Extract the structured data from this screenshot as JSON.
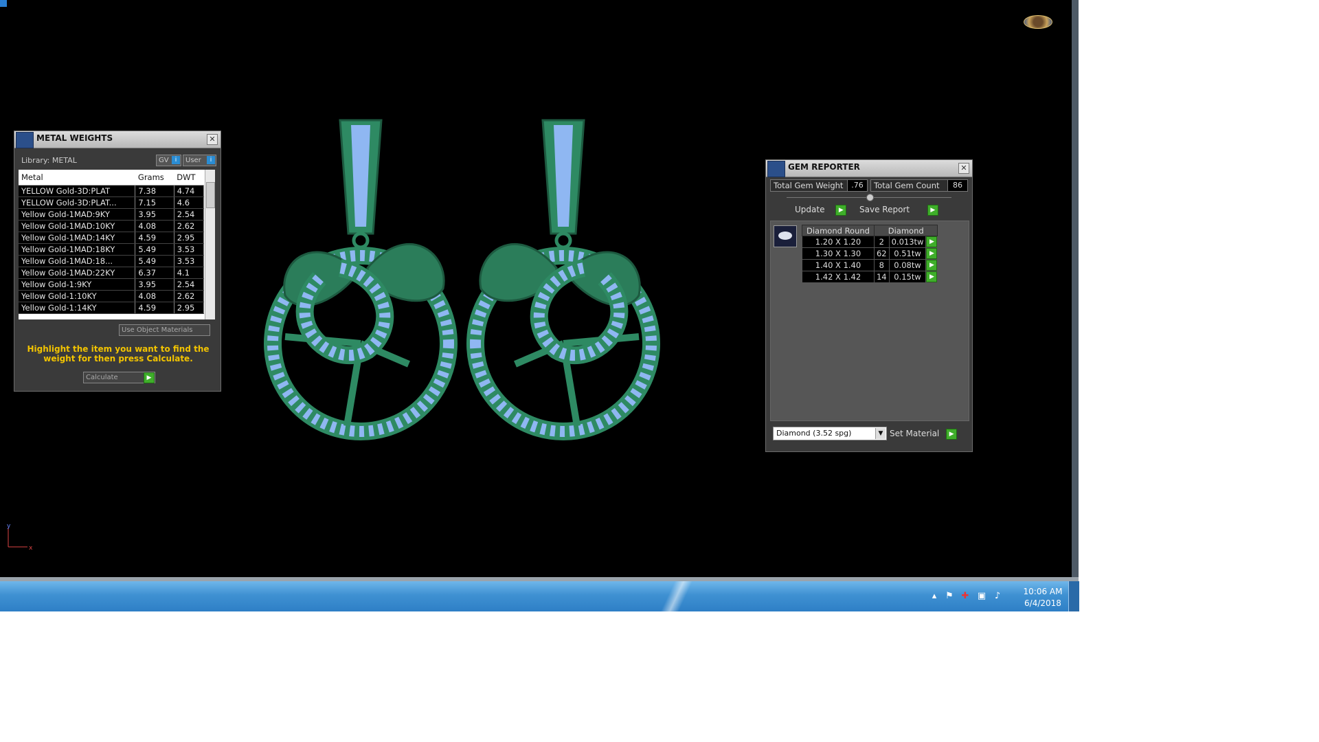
{
  "metal_weights": {
    "title": "METAL WEIGHTS",
    "library": "Library: METAL",
    "gv_label": "GV",
    "user_label": "User",
    "columns": [
      "Metal",
      "Grams",
      "DWT"
    ],
    "rows": [
      [
        "YELLOW Gold-3D:PLAT",
        "7.38",
        "4.74"
      ],
      [
        "YELLOW Gold-3D:PLAT...",
        "7.15",
        "4.6"
      ],
      [
        "Yellow Gold-1MAD:9KY",
        "3.95",
        "2.54"
      ],
      [
        "Yellow Gold-1MAD:10KY",
        "4.08",
        "2.62"
      ],
      [
        "Yellow Gold-1MAD:14KY",
        "4.59",
        "2.95"
      ],
      [
        "Yellow Gold-1MAD:18KY",
        "5.49",
        "3.53"
      ],
      [
        "Yellow Gold-1MAD:18...",
        "5.49",
        "3.53"
      ],
      [
        "Yellow Gold-1MAD:22KY",
        "6.37",
        "4.1"
      ],
      [
        "Yellow Gold-1:9KY",
        "3.95",
        "2.54"
      ],
      [
        "Yellow Gold-1:10KY",
        "4.08",
        "2.62"
      ],
      [
        "Yellow Gold-1:14KY",
        "4.59",
        "2.95"
      ]
    ],
    "use_object_materials": "Use Object Materials",
    "hint": "Highlight the item you want to find the weight for then press Calculate.",
    "calculate": "Calculate"
  },
  "gem_reporter": {
    "title": "GEM REPORTER",
    "total_weight_label": "Total Gem Weight",
    "total_weight_value": ".76",
    "total_count_label": "Total Gem Count",
    "total_count_value": "86",
    "update": "Update",
    "save_report": "Save Report",
    "table_headers": [
      "Diamond Round",
      "Diamond"
    ],
    "rows": [
      [
        "1.20 X 1.20",
        "2",
        "0.013tw"
      ],
      [
        "1.30 X 1.30",
        "62",
        "0.51tw"
      ],
      [
        "1.40 X 1.40",
        "8",
        "0.08tw"
      ],
      [
        "1.42 X 1.42",
        "14",
        "0.15tw"
      ]
    ],
    "material_select": "Diamond    (3.52 spg)",
    "set_material": "Set Material"
  },
  "axis": {
    "y": "y",
    "x": "x"
  },
  "taskbar": {
    "time": "10:06 AM",
    "date": "6/4/2018"
  },
  "colors": {
    "metal": "#2e8a63",
    "gem": "#8fb7f2",
    "bead": "#7a2fa0"
  },
  "icons": [
    "close-icon",
    "info-icon",
    "play-icon",
    "dropdown-arrow-icon",
    "flag-icon",
    "network-icon",
    "speaker-icon",
    "tray-arrow-icon"
  ]
}
